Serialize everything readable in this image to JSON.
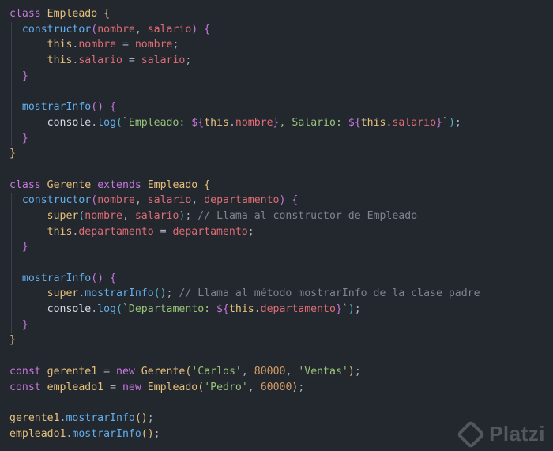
{
  "editor": {
    "language": "javascript",
    "theme_colors": {
      "background": "#23272e",
      "keyword": "#c678dd",
      "class_name": "#e5c07b",
      "function": "#61afef",
      "parameter": "#e06c75",
      "string": "#98c379",
      "number": "#d19a66",
      "comment": "#7f848e"
    }
  },
  "code": {
    "l1": {
      "kw": "class",
      "name": "Empleado",
      "open": "{"
    },
    "l2": {
      "fn": "constructor",
      "p1": "nombre",
      "p2": "salario",
      "open": "{"
    },
    "l3": {
      "this": "this",
      "prop": "nombre",
      "val": "nombre"
    },
    "l4": {
      "this": "this",
      "prop": "salario",
      "val": "salario"
    },
    "l5": {
      "close": "}"
    },
    "l7": {
      "fn": "mostrarInfo",
      "open": "{"
    },
    "l8": {
      "obj": "console",
      "fn": "log",
      "tpl1": "`Empleado: ",
      "this1": "this",
      "prop1": "nombre",
      "tpl2": ", Salario: ",
      "this2": "this",
      "prop2": "salario",
      "tpl3": "`"
    },
    "l9": {
      "close": "}"
    },
    "l10": {
      "close": "}"
    },
    "l12": {
      "kw": "class",
      "name": "Gerente",
      "kw2": "extends",
      "parent": "Empleado",
      "open": "{"
    },
    "l13": {
      "fn": "constructor",
      "p1": "nombre",
      "p2": "salario",
      "p3": "departamento",
      "open": "{"
    },
    "l14": {
      "kw": "super",
      "a1": "nombre",
      "a2": "salario",
      "comment": "// Llama al constructor de Empleado"
    },
    "l15": {
      "this": "this",
      "prop": "departamento",
      "val": "departamento"
    },
    "l16": {
      "close": "}"
    },
    "l18": {
      "fn": "mostrarInfo",
      "open": "{"
    },
    "l19": {
      "kw": "super",
      "fn": "mostrarInfo",
      "comment": "// Llama al método mostrarInfo de la clase padre"
    },
    "l20": {
      "obj": "console",
      "fn": "log",
      "tpl1": "`Departamento: ",
      "this1": "this",
      "prop1": "departamento",
      "tpl3": "`"
    },
    "l21": {
      "close": "}"
    },
    "l22": {
      "close": "}"
    },
    "l24": {
      "kw": "const",
      "var": "gerente1",
      "kw2": "new",
      "cls": "Gerente",
      "s1": "'Carlos'",
      "n1": "80000",
      "s2": "'Ventas'"
    },
    "l25": {
      "kw": "const",
      "var": "empleado1",
      "kw2": "new",
      "cls": "Empleado",
      "s1": "'Pedro'",
      "n1": "60000"
    },
    "l27": {
      "var": "gerente1",
      "fn": "mostrarInfo"
    },
    "l28": {
      "var": "empleado1",
      "fn": "mostrarInfo"
    }
  },
  "watermark": {
    "logo_icon": "platzi-logo-icon",
    "text": "Platzi"
  }
}
